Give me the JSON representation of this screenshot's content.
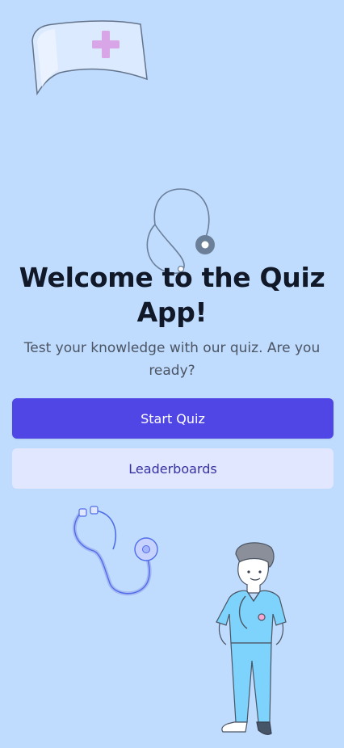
{
  "hero": {
    "title": "Welcome to the Quiz App!",
    "subtitle": "Test your knowledge with our quiz. Are you ready?"
  },
  "actions": {
    "start_label": "Start Quiz",
    "leaderboards_label": "Leaderboards"
  },
  "illustrations": {
    "nurse_cap": "nurse-cap-icon",
    "stethoscope_top": "stethoscope-icon",
    "stethoscope_bottom": "stethoscope-icon",
    "nurse": "nurse-illustration"
  },
  "colors": {
    "background": "#bfdbfe",
    "primary_button": "#4f46e5",
    "primary_button_text": "#ffffff",
    "secondary_button": "#e0e7ff",
    "secondary_button_text": "#3730a3",
    "title_text": "#111827",
    "subtitle_text": "#4b5563"
  }
}
